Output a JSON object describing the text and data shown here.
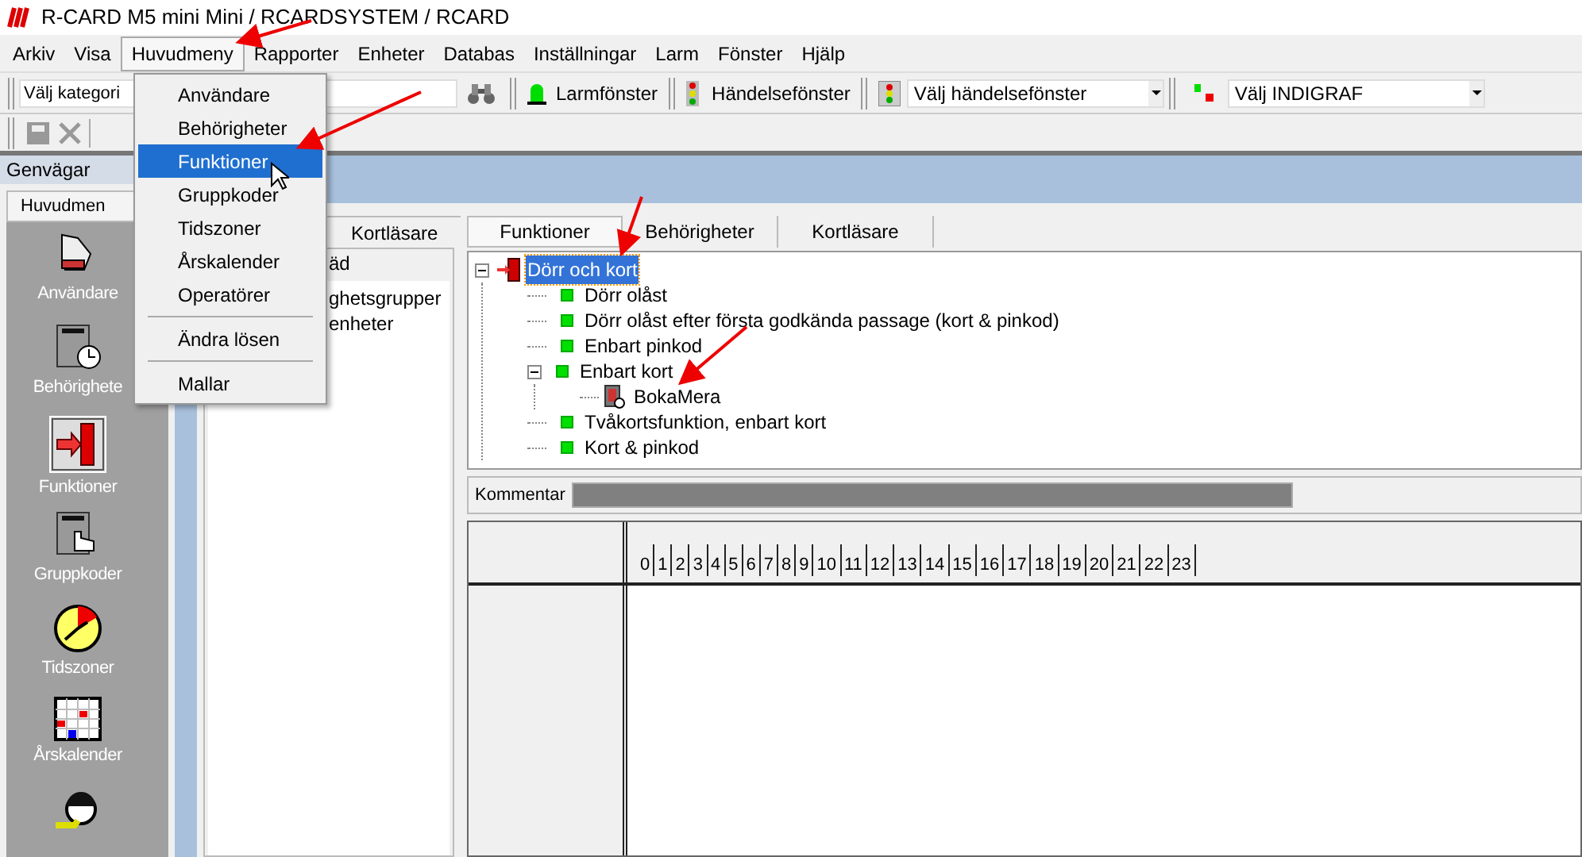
{
  "window": {
    "title": "R-CARD M5 mini Mini  / RCARDSYSTEM / RCARD"
  },
  "menu_bar": [
    {
      "label": "Arkiv",
      "open": false
    },
    {
      "label": "Visa",
      "open": false
    },
    {
      "label": "Huvudmeny",
      "open": true
    },
    {
      "label": "Rapporter",
      "open": false
    },
    {
      "label": "Enheter",
      "open": false
    },
    {
      "label": "Databas",
      "open": false
    },
    {
      "label": "Inställningar",
      "open": false
    },
    {
      "label": "Larm",
      "open": false
    },
    {
      "label": "Fönster",
      "open": false
    },
    {
      "label": "Hjälp",
      "open": false
    }
  ],
  "dropdown_menu": [
    {
      "kind": "item",
      "label": "Användare",
      "selected": false
    },
    {
      "kind": "item",
      "label": "Behörigheter",
      "selected": false
    },
    {
      "kind": "item",
      "label": "Funktioner",
      "selected": true
    },
    {
      "kind": "item",
      "label": "Gruppkoder",
      "selected": false
    },
    {
      "kind": "item",
      "label": "Tidszoner",
      "selected": false
    },
    {
      "kind": "item",
      "label": "Årskalender",
      "selected": false
    },
    {
      "kind": "item",
      "label": "Operatörer",
      "selected": false
    },
    {
      "kind": "separator"
    },
    {
      "kind": "item",
      "label": "Ändra lösen",
      "selected": false
    },
    {
      "kind": "separator"
    },
    {
      "kind": "item",
      "label": "Mallar",
      "selected": false
    }
  ],
  "toolbar": {
    "category_field": {
      "value": "Välj kategori"
    },
    "alarm_button": "Larmfönster",
    "event_button": "Händelsefönster",
    "event_select": {
      "value": "Välj händelsefönster"
    },
    "indigraf_select": {
      "value": "Välj INDIGRAF"
    }
  },
  "sidebar": {
    "header": "Genvägar",
    "tab": "Huvudmen",
    "shortcuts": [
      {
        "label": "Användare",
        "selected": false
      },
      {
        "label": "Behörighete",
        "selected": false
      },
      {
        "label": "Funktioner",
        "selected": true
      },
      {
        "label": "Gruppkoder",
        "selected": false
      },
      {
        "label": "Tidszoner",
        "selected": false
      },
      {
        "label": "Årskalender",
        "selected": false
      },
      {
        "selected": false
      }
    ]
  },
  "middle_panel": {
    "tabs": [
      {
        "label": "Kortläsare",
        "selected": false
      }
    ],
    "header": "äd",
    "items": [
      "ghetsgrupper",
      "enheter"
    ]
  },
  "right_panel": {
    "tabs": [
      {
        "label": "Funktioner",
        "selected": true
      },
      {
        "label": "Behörigheter",
        "selected": false
      },
      {
        "label": "Kortläsare",
        "selected": false
      }
    ],
    "tree": [
      {
        "label": "Dörr och kort",
        "kind": "door",
        "selected": true,
        "expanded": true,
        "children": [
          {
            "label": "Dörr olåst",
            "kind": "mode",
            "selected": false
          },
          {
            "label": "Dörr olåst efter första godkända passage (kort & pinkod)",
            "kind": "mode",
            "selected": false
          },
          {
            "label": "Enbart pinkod",
            "kind": "mode",
            "selected": false
          },
          {
            "label": "Enbart kort",
            "kind": "mode",
            "selected": false,
            "expanded": true,
            "children": [
              {
                "label": "BokaMera",
                "kind": "device",
                "selected": false
              }
            ]
          },
          {
            "label": "Tvåkortsfunktion, enbart kort",
            "kind": "mode",
            "selected": false
          },
          {
            "label": "Kort & pinkod",
            "kind": "mode",
            "selected": false
          }
        ]
      }
    ],
    "comment_label": "Kommentar",
    "hours": [
      "0",
      "1",
      "2",
      "3",
      "4",
      "5",
      "6",
      "7",
      "8",
      "9",
      "10",
      "11",
      "12",
      "13",
      "14",
      "15",
      "16",
      "17",
      "18",
      "19",
      "20",
      "21",
      "22",
      "23"
    ]
  }
}
